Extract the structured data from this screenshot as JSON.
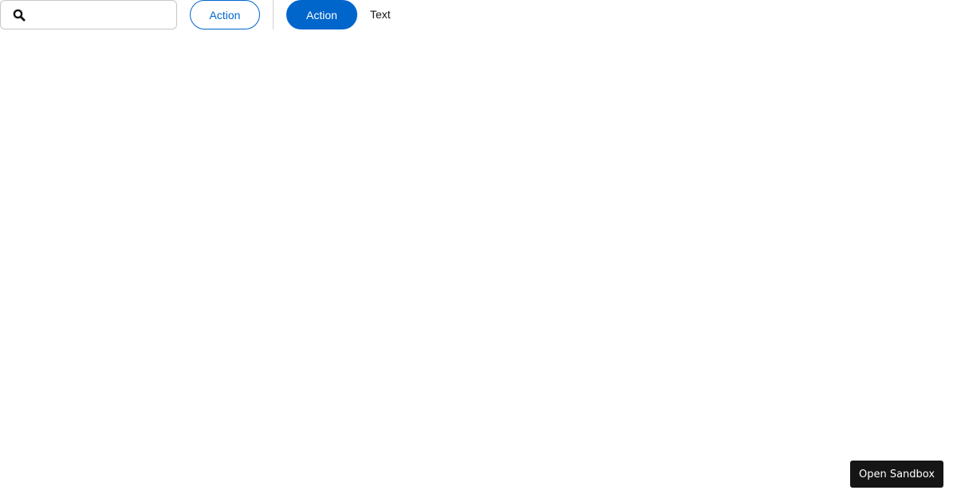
{
  "toolbar": {
    "search": {
      "value": "",
      "placeholder": "",
      "icon": "search-icon"
    },
    "secondary_action_label": "Action",
    "primary_action_label": "Action",
    "text_item": "Text"
  },
  "sandbox": {
    "label": "Open Sandbox"
  },
  "colors": {
    "accent": "#0066cc",
    "text": "#151515",
    "border": "#c7c7c7",
    "divider": "#d2d2d2",
    "sandbox_background": "#151515"
  }
}
